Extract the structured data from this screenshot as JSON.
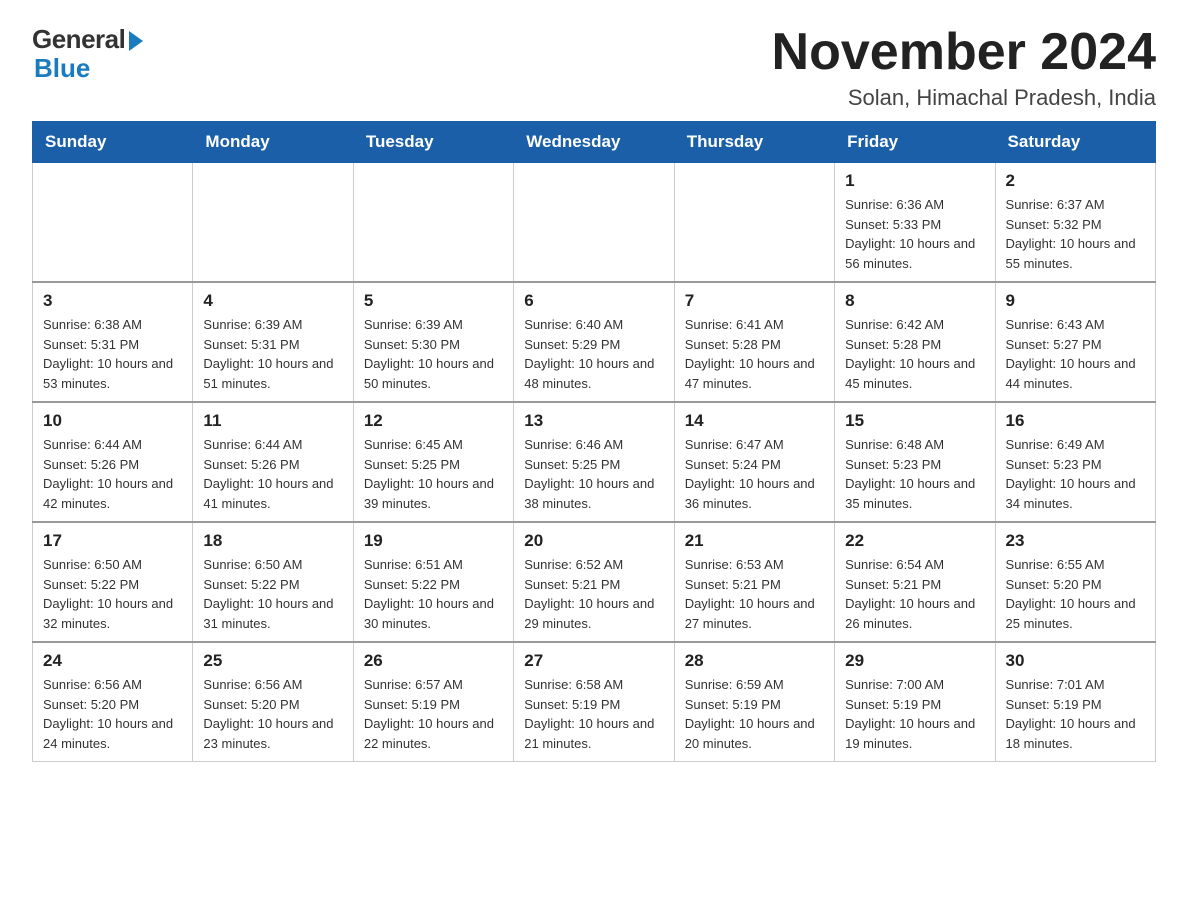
{
  "header": {
    "logo": {
      "general": "General",
      "blue": "Blue"
    },
    "title": "November 2024",
    "location": "Solan, Himachal Pradesh, India"
  },
  "days_of_week": [
    "Sunday",
    "Monday",
    "Tuesday",
    "Wednesday",
    "Thursday",
    "Friday",
    "Saturday"
  ],
  "weeks": [
    [
      {
        "day": "",
        "info": ""
      },
      {
        "day": "",
        "info": ""
      },
      {
        "day": "",
        "info": ""
      },
      {
        "day": "",
        "info": ""
      },
      {
        "day": "",
        "info": ""
      },
      {
        "day": "1",
        "info": "Sunrise: 6:36 AM\nSunset: 5:33 PM\nDaylight: 10 hours and 56 minutes."
      },
      {
        "day": "2",
        "info": "Sunrise: 6:37 AM\nSunset: 5:32 PM\nDaylight: 10 hours and 55 minutes."
      }
    ],
    [
      {
        "day": "3",
        "info": "Sunrise: 6:38 AM\nSunset: 5:31 PM\nDaylight: 10 hours and 53 minutes."
      },
      {
        "day": "4",
        "info": "Sunrise: 6:39 AM\nSunset: 5:31 PM\nDaylight: 10 hours and 51 minutes."
      },
      {
        "day": "5",
        "info": "Sunrise: 6:39 AM\nSunset: 5:30 PM\nDaylight: 10 hours and 50 minutes."
      },
      {
        "day": "6",
        "info": "Sunrise: 6:40 AM\nSunset: 5:29 PM\nDaylight: 10 hours and 48 minutes."
      },
      {
        "day": "7",
        "info": "Sunrise: 6:41 AM\nSunset: 5:28 PM\nDaylight: 10 hours and 47 minutes."
      },
      {
        "day": "8",
        "info": "Sunrise: 6:42 AM\nSunset: 5:28 PM\nDaylight: 10 hours and 45 minutes."
      },
      {
        "day": "9",
        "info": "Sunrise: 6:43 AM\nSunset: 5:27 PM\nDaylight: 10 hours and 44 minutes."
      }
    ],
    [
      {
        "day": "10",
        "info": "Sunrise: 6:44 AM\nSunset: 5:26 PM\nDaylight: 10 hours and 42 minutes."
      },
      {
        "day": "11",
        "info": "Sunrise: 6:44 AM\nSunset: 5:26 PM\nDaylight: 10 hours and 41 minutes."
      },
      {
        "day": "12",
        "info": "Sunrise: 6:45 AM\nSunset: 5:25 PM\nDaylight: 10 hours and 39 minutes."
      },
      {
        "day": "13",
        "info": "Sunrise: 6:46 AM\nSunset: 5:25 PM\nDaylight: 10 hours and 38 minutes."
      },
      {
        "day": "14",
        "info": "Sunrise: 6:47 AM\nSunset: 5:24 PM\nDaylight: 10 hours and 36 minutes."
      },
      {
        "day": "15",
        "info": "Sunrise: 6:48 AM\nSunset: 5:23 PM\nDaylight: 10 hours and 35 minutes."
      },
      {
        "day": "16",
        "info": "Sunrise: 6:49 AM\nSunset: 5:23 PM\nDaylight: 10 hours and 34 minutes."
      }
    ],
    [
      {
        "day": "17",
        "info": "Sunrise: 6:50 AM\nSunset: 5:22 PM\nDaylight: 10 hours and 32 minutes."
      },
      {
        "day": "18",
        "info": "Sunrise: 6:50 AM\nSunset: 5:22 PM\nDaylight: 10 hours and 31 minutes."
      },
      {
        "day": "19",
        "info": "Sunrise: 6:51 AM\nSunset: 5:22 PM\nDaylight: 10 hours and 30 minutes."
      },
      {
        "day": "20",
        "info": "Sunrise: 6:52 AM\nSunset: 5:21 PM\nDaylight: 10 hours and 29 minutes."
      },
      {
        "day": "21",
        "info": "Sunrise: 6:53 AM\nSunset: 5:21 PM\nDaylight: 10 hours and 27 minutes."
      },
      {
        "day": "22",
        "info": "Sunrise: 6:54 AM\nSunset: 5:21 PM\nDaylight: 10 hours and 26 minutes."
      },
      {
        "day": "23",
        "info": "Sunrise: 6:55 AM\nSunset: 5:20 PM\nDaylight: 10 hours and 25 minutes."
      }
    ],
    [
      {
        "day": "24",
        "info": "Sunrise: 6:56 AM\nSunset: 5:20 PM\nDaylight: 10 hours and 24 minutes."
      },
      {
        "day": "25",
        "info": "Sunrise: 6:56 AM\nSunset: 5:20 PM\nDaylight: 10 hours and 23 minutes."
      },
      {
        "day": "26",
        "info": "Sunrise: 6:57 AM\nSunset: 5:19 PM\nDaylight: 10 hours and 22 minutes."
      },
      {
        "day": "27",
        "info": "Sunrise: 6:58 AM\nSunset: 5:19 PM\nDaylight: 10 hours and 21 minutes."
      },
      {
        "day": "28",
        "info": "Sunrise: 6:59 AM\nSunset: 5:19 PM\nDaylight: 10 hours and 20 minutes."
      },
      {
        "day": "29",
        "info": "Sunrise: 7:00 AM\nSunset: 5:19 PM\nDaylight: 10 hours and 19 minutes."
      },
      {
        "day": "30",
        "info": "Sunrise: 7:01 AM\nSunset: 5:19 PM\nDaylight: 10 hours and 18 minutes."
      }
    ]
  ]
}
